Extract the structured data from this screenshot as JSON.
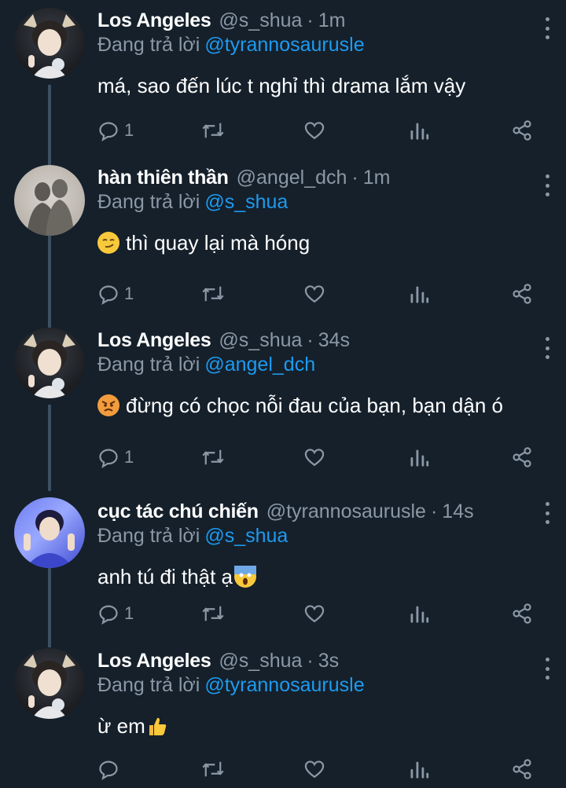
{
  "colors": {
    "background": "#15202b",
    "link": "#1d9bf0",
    "muted": "#8b98a5",
    "thread_line": "#3d4f61"
  },
  "icons": [
    "reply-icon",
    "retweet-icon",
    "like-icon",
    "analytics-icon",
    "share-icon",
    "more-icon"
  ],
  "tweets": [
    {
      "display_name": "Los Angeles",
      "handle": "@s_shua",
      "dot": "·",
      "time": "1m",
      "reply_prefix": "Đang trả lời",
      "reply_to": "@tyrannosaurusle",
      "text": "má, sao đến lúc t nghỉ thì drama lắm vậy",
      "emoji_before": "",
      "emoji_after": "",
      "reply_count": "1"
    },
    {
      "display_name": "hàn thiên thần",
      "handle": "@angel_dch",
      "dot": "·",
      "time": "1m",
      "reply_prefix": "Đang trả lời",
      "reply_to": "@s_shua",
      "text": "thì quay lại mà hóng",
      "emoji_before": "smirk-emoji",
      "emoji_after": "",
      "reply_count": "1"
    },
    {
      "display_name": "Los Angeles",
      "handle": "@s_shua",
      "dot": "·",
      "time": "34s",
      "reply_prefix": "Đang trả lời",
      "reply_to": "@angel_dch",
      "text": "đừng có chọc nỗi đau của bạn, bạn dận ó",
      "emoji_before": "angry-emoji",
      "emoji_after": "",
      "reply_count": "1"
    },
    {
      "display_name": "cục tác chú chiến",
      "handle": "@tyrannosaurusle",
      "dot": "·",
      "time": "14s",
      "reply_prefix": "Đang trả lời",
      "reply_to": "@s_shua",
      "text": "anh tú đi thật ạ",
      "emoji_before": "",
      "emoji_after": "scream-emoji",
      "reply_count": "1"
    },
    {
      "display_name": "Los Angeles",
      "handle": "@s_shua",
      "dot": "·",
      "time": "3s",
      "reply_prefix": "Đang trả lời",
      "reply_to": "@tyrannosaurusle",
      "text": "ừ em",
      "emoji_before": "",
      "emoji_after": "thumbs-up-emoji",
      "reply_count": ""
    }
  ]
}
